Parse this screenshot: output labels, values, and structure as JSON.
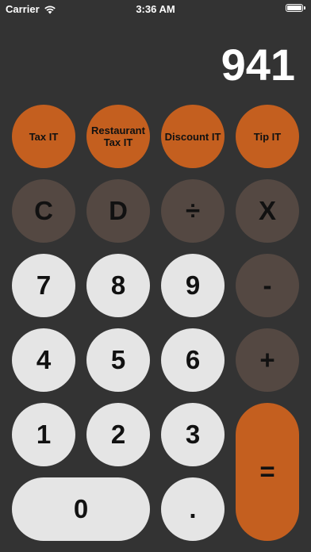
{
  "status_bar": {
    "carrier": "Carrier",
    "time": "3:36 AM"
  },
  "display": {
    "value": "941"
  },
  "buttons": {
    "tax": "Tax IT",
    "restaurant_tax_line1": "Restaurant",
    "restaurant_tax_line2": "Tax IT",
    "discount": "Discount IT",
    "tip": "Tip IT",
    "clear": "C",
    "delete": "D",
    "divide": "÷",
    "multiply": "X",
    "seven": "7",
    "eight": "8",
    "nine": "9",
    "minus": "-",
    "four": "4",
    "five": "5",
    "six": "6",
    "plus": "+",
    "one": "1",
    "two": "2",
    "three": "3",
    "equals": "=",
    "zero": "0",
    "decimal": "."
  },
  "colors": {
    "background": "#333333",
    "accent_orange": "#c45f1f",
    "operator_dark": "#544842",
    "digit_light": "#e5e5e5"
  },
  "icons": {
    "wifi": "wifi-icon",
    "battery": "battery-icon"
  }
}
